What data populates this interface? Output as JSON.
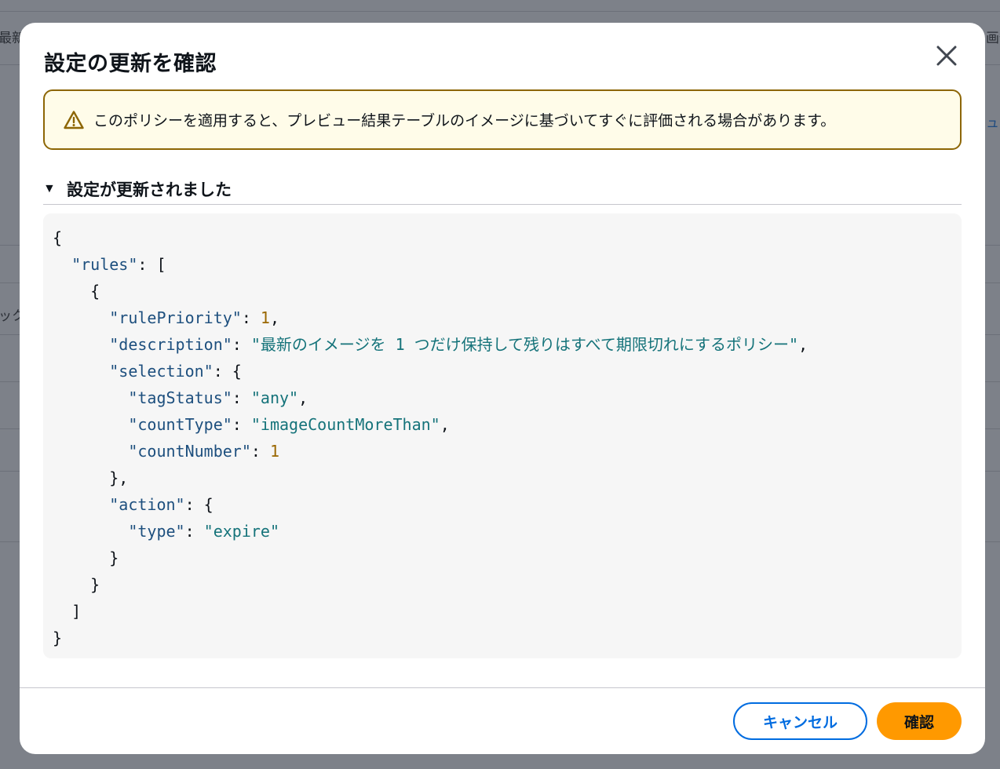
{
  "background": {
    "left_fragments": [
      "最新",
      "ック"
    ],
    "right_fragments": [
      "画像",
      "ュー"
    ]
  },
  "modal": {
    "title": "設定の更新を確認",
    "close_icon": "close-icon",
    "alert": {
      "icon": "warning-icon",
      "text": "このポリシーを適用すると、プレビュー結果テーブルのイメージに基づいてすぐに評価される場合があります。",
      "border_color": "#8d6605",
      "background_color": "#fffce9"
    },
    "expander": {
      "caret": "▼",
      "title": "設定が更新されました"
    },
    "code": {
      "rules_key": "\"rules\"",
      "rulePriority_key": "\"rulePriority\"",
      "rulePriority_value": "1",
      "description_key": "\"description\"",
      "description_value": "\"最新のイメージを 1 つだけ保持して残りはすべて期限切れにするポリシー\"",
      "selection_key": "\"selection\"",
      "tagStatus_key": "\"tagStatus\"",
      "tagStatus_value": "\"any\"",
      "countType_key": "\"countType\"",
      "countType_value": "\"imageCountMoreThan\"",
      "countNumber_key": "\"countNumber\"",
      "countNumber_value": "1",
      "action_key": "\"action\"",
      "type_key": "\"type\"",
      "type_value": "\"expire\""
    },
    "buttons": {
      "cancel_label": "キャンセル",
      "confirm_label": "確認"
    },
    "colors": {
      "primary": "#ff9900",
      "link": "#006ce0"
    }
  }
}
